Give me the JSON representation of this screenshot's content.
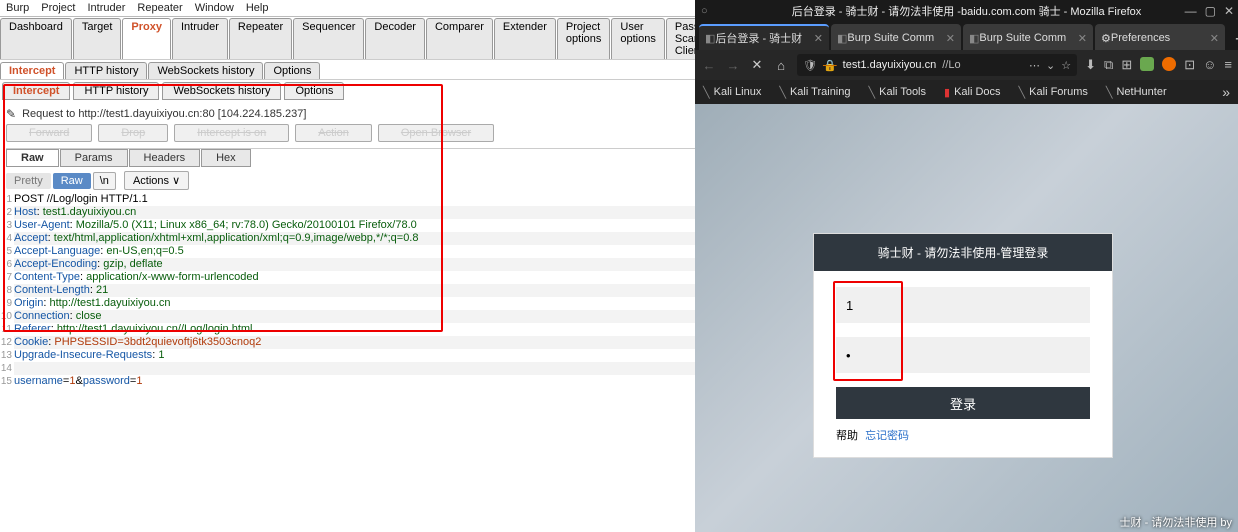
{
  "burp": {
    "menu": [
      "Burp",
      "Project",
      "Intruder",
      "Repeater",
      "Window",
      "Help"
    ],
    "mainTabs": [
      "Dashboard",
      "Target",
      "Proxy",
      "Intruder",
      "Repeater",
      "Sequencer",
      "Decoder",
      "Comparer",
      "Extender",
      "Project options",
      "User options",
      "Passive Scan Client"
    ],
    "subTabs": [
      "Intercept",
      "HTTP history",
      "WebSockets history",
      "Options"
    ],
    "interceptTabs": [
      "Intercept",
      "HTTP history",
      "WebSockets history",
      "Options"
    ],
    "requestTo": "Request to http://test1.dayuixiyou.cn:80 [104.224.185.237]",
    "btns": {
      "forward": "Forward",
      "drop": "Drop",
      "intercept": "Intercept is on",
      "action": "Action",
      "open": "Open Browser"
    },
    "fmtTabs": [
      "Raw",
      "Params",
      "Headers",
      "Hex"
    ],
    "pretty": "Pretty",
    "raw": "Raw",
    "nl": "\\n",
    "actions": "Actions ∨"
  },
  "req": [
    {
      "l": "POST //Log/login HTTP/1.1",
      "t": "req"
    },
    {
      "h": "Host",
      "v": "test1.dayuixiyou.cn"
    },
    {
      "h": "User-Agent",
      "v": "Mozilla/5.0 (X11; Linux x86_64; rv:78.0) Gecko/20100101 Firefox/78.0"
    },
    {
      "h": "Accept",
      "v": "text/html,application/xhtml+xml,application/xml;q=0.9,image/webp,*/*;q=0.8"
    },
    {
      "h": "Accept-Language",
      "v": "en-US,en;q=0.5"
    },
    {
      "h": "Accept-Encoding",
      "v": "gzip, deflate"
    },
    {
      "h": "Content-Type",
      "v": "application/x-www-form-urlencoded"
    },
    {
      "h": "Content-Length",
      "v": "21"
    },
    {
      "h": "Origin",
      "v": "http://test1.dayuixiyou.cn"
    },
    {
      "h": "Connection",
      "v": "close"
    },
    {
      "h": "Referer",
      "v": "http://test1.dayuixiyou.cn//Log/login.html"
    },
    {
      "h": "Cookie",
      "v": "PHPSESSID=3bdt2quievoftj6tk3503cnoq2",
      "ck": true
    },
    {
      "h": "Upgrade-Insecure-Requests",
      "v": "1"
    },
    {
      "l": "",
      "t": "blank"
    },
    {
      "l": "username=1&password=1",
      "t": "body"
    }
  ],
  "ff": {
    "title": "后台登录 - 骑士财 - 请勿法非使用 -baidu.com.com 骑士 - Mozilla Firefox",
    "tabs": [
      {
        "label": "后台登录 - 骑士财",
        "active": true
      },
      {
        "label": "Burp Suite Comm"
      },
      {
        "label": "Burp Suite Comm"
      },
      {
        "label": "Preferences",
        "gear": true
      }
    ],
    "url": {
      "host": "test1.dayuixiyou.cn",
      "path": "//Lo"
    },
    "bookmarks": [
      "Kali Linux",
      "Kali Training",
      "Kali Tools",
      "Kali Docs",
      "Kali Forums",
      "NetHunter"
    ],
    "login": {
      "header": "骑士财 - 请勿法非使用-管理登录",
      "user": "1",
      "pass": "•",
      "btn": "登录",
      "help": "帮助",
      "forgot": "忘记密码"
    },
    "footer": "士财 - 请勿法非使用 by"
  }
}
